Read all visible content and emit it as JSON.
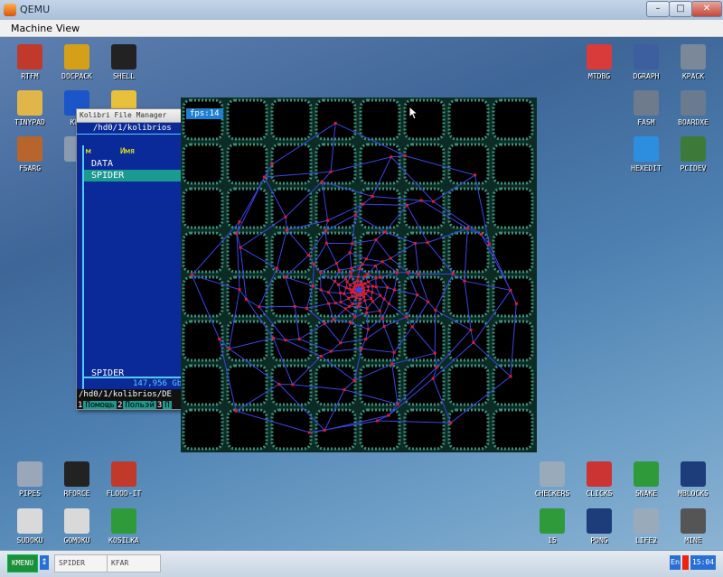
{
  "window": {
    "title": "QEMU",
    "minimize": "–",
    "maximize": "□",
    "close": "✕"
  },
  "menu": [
    "Machine",
    "View"
  ],
  "desktop_icons_left": [
    {
      "label": "RTFM",
      "icon": "document-icon",
      "color": "#c0392b"
    },
    {
      "label": "DOCPACK",
      "icon": "folder-icon",
      "color": "#d4a017"
    },
    {
      "label": "SHELL",
      "icon": "terminal-icon",
      "color": "#222"
    },
    {
      "label": "TINYPAD",
      "icon": "notepad-icon",
      "color": "#e0b64a"
    },
    {
      "label": "KFM",
      "icon": "filemanager-icon",
      "color": "#1c55c8"
    },
    {
      "label": "",
      "icon": "pencil-icon",
      "color": "#e8c13c"
    },
    {
      "label": "FSARG",
      "icon": "disks-icon",
      "color": "#b7652c"
    },
    {
      "label": "",
      "icon": "app-icon",
      "color": "#8a9bb0"
    }
  ],
  "desktop_icons_right": [
    {
      "label": "MTDBG",
      "icon": "debug-icon",
      "color": "#d93a3a"
    },
    {
      "label": "DGRAPH",
      "icon": "window-icon",
      "color": "#3d5fa0"
    },
    {
      "label": "KPACK",
      "icon": "package-icon",
      "color": "#7a8899"
    },
    {
      "label": "FASM",
      "icon": "assembler-icon",
      "color": "#6d7b8c"
    },
    {
      "label": "BOARDXE",
      "icon": "board-icon",
      "color": "#6a7b90"
    },
    {
      "label": "HEXEDIT",
      "icon": "hexedit-icon",
      "color": "#2d8ee0"
    },
    {
      "label": "PCIDEV",
      "icon": "pci-icon",
      "color": "#3d7a3a"
    }
  ],
  "desktop_icons_bottom_left": [
    {
      "label": "PIPES",
      "icon": "pipes-icon",
      "color": "#9aa7b8"
    },
    {
      "label": "RFORCE",
      "icon": "tetris-icon",
      "color": "#222"
    },
    {
      "label": "FLOOD-IT",
      "icon": "cube-icon",
      "color": "#c0392b"
    },
    {
      "label": "SUDOKU",
      "icon": "sudoku-icon",
      "color": "#d9d9d9"
    },
    {
      "label": "GOMOKU",
      "icon": "gomoku-icon",
      "color": "#d9d9d9"
    },
    {
      "label": "KOSILKA",
      "icon": "lawnmower-icon",
      "color": "#2e9a3a"
    }
  ],
  "desktop_icons_bottom_right": [
    {
      "label": "CHECKERS",
      "icon": "checkers-icon",
      "color": "#9ab"
    },
    {
      "label": "CLICKS",
      "icon": "blocks-icon",
      "color": "#c33"
    },
    {
      "label": "SNAKE",
      "icon": "snake-icon",
      "color": "#2e9a3a"
    },
    {
      "label": "MBLOCKS",
      "icon": "mblocks-icon",
      "color": "#1c3c7a"
    },
    {
      "label": "15",
      "icon": "fifteen-icon",
      "color": "#2e9a3a"
    },
    {
      "label": "PONG",
      "icon": "pong-icon",
      "color": "#1c3c7a"
    },
    {
      "label": "LIFE2",
      "icon": "life-icon",
      "color": "#9ab"
    },
    {
      "label": "MINE",
      "icon": "mine-icon",
      "color": "#555"
    }
  ],
  "kfm": {
    "caption": "Kolibri File Manager",
    "path_top": "/hd0/1/kolibrios",
    "col_m": "м",
    "col_name": "Имя",
    "rows": [
      "DATA",
      "SPIDER"
    ],
    "selected_index": 1,
    "selected_file": "SPIDER",
    "size_text": "147,956 Gb",
    "path_bottom": "/hd0/1/kolibrios/DE",
    "fkeys": [
      {
        "k": "1",
        "v": "Помощь"
      },
      {
        "k": "2",
        "v": "Польэй"
      },
      {
        "k": "3",
        "v": "П"
      }
    ]
  },
  "spider": {
    "fps_label": "fps:14",
    "web_color": "#3b45e8",
    "node_color": "#e61a2a"
  },
  "taskbar": {
    "start_label": "KMENU",
    "switch_label": "↕",
    "tasks": [
      "SPIDER",
      "KFAR"
    ],
    "lang": "En",
    "clock": "15:04"
  }
}
